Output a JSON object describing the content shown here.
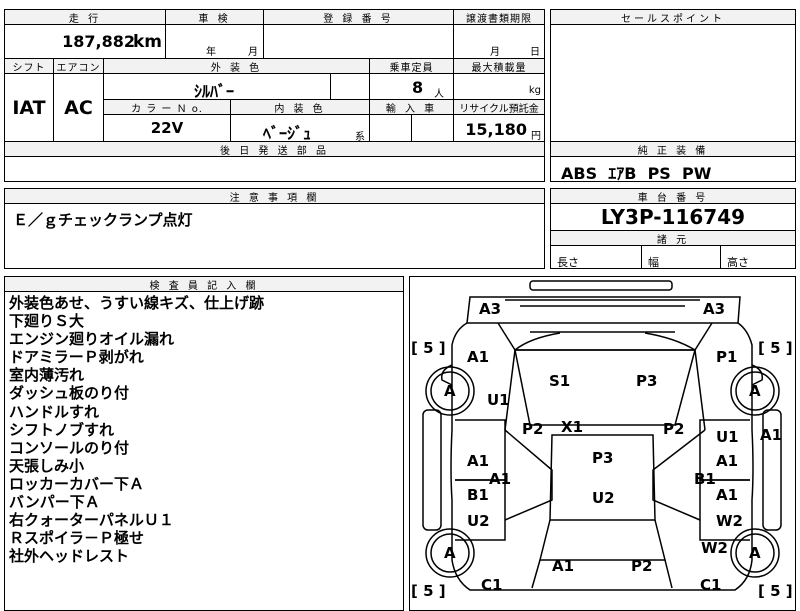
{
  "top_row": {
    "mileage_label": "走 行",
    "inspection_label": "車 検",
    "registration_label": "登 録 番 号",
    "transfer_label": "譲渡書類期限",
    "sales_point_label": "セールスポイント",
    "mileage_value": "187,882",
    "mileage_unit": "km",
    "year_unit": "年",
    "month_unit": "月",
    "month_unit2": "月",
    "day_unit": "日"
  },
  "spec_row": {
    "shift_label": "シフト",
    "aircon_label": "エアコン",
    "exterior_color_label": "外 装 色",
    "capacity_label": "乗車定員",
    "max_load_label": "最大積載量",
    "shift_value": "IAT",
    "aircon_value": "AC",
    "exterior_color_value": "ｼﾙﾊﾞｰ",
    "capacity_value": "8",
    "capacity_unit": "人",
    "load_unit": "kg",
    "color_no_label": "カ ラ ー Ｎ o.",
    "interior_color_label": "内 装 色",
    "import_label": "輸 入 車",
    "recycle_label": "リサイクル預託金",
    "color_no_value": "22V",
    "interior_color_value": "ﾍﾞｰｼﾞｭ",
    "interior_suffix": "系",
    "recycle_value": "15,180",
    "recycle_unit": "円"
  },
  "later_parts_label": "後 日 発 送 部 品",
  "equipment": {
    "label": "純 正 装 備",
    "value": "ABS  ｴｱB  PS  PW"
  },
  "caution": {
    "label": "注 意 事 項 欄",
    "value": "Ｅ／ｇチェックランプ点灯"
  },
  "chassis": {
    "label": "車 台 番 号",
    "value": "LY3P-116749"
  },
  "dimensions": {
    "label": "諸 元",
    "length_label": "長さ",
    "width_label": "幅",
    "height_label": "高さ"
  },
  "inspector": {
    "label": "検 査 員 記 入 欄",
    "lines": [
      "外装色あせ、うすい線キズ、仕上げ跡",
      "下廻りＳ大",
      "エンジン廻りオイル漏れ",
      "ドアミラーＰ剥がれ",
      "室内薄汚れ",
      "ダッシュ板のり付",
      "ハンドルすれ",
      "シフトノブすれ",
      "コンソールのり付",
      "天張しみ小",
      "ロッカーカバー下Ａ",
      "バンパー下Ａ",
      "右クォーターパネルＵ１",
      "Ｒスポイラ－Ｐ極せ",
      "社外ヘッドレスト"
    ]
  },
  "diagram": {
    "tire_label": "A",
    "tread_bracket": "[ 5 ]",
    "marks": {
      "front_left": "A3",
      "front_right": "A3",
      "fender_left": "A1",
      "fender_right": "P1",
      "mirror_left": "U1",
      "windshield_left": "S1",
      "windshield_right": "P3",
      "pillar_left": "P2",
      "pillar_right": "P2",
      "roof_top": "X1",
      "roof": "P3",
      "door_f_left": "A1",
      "door_f_right_1": "U1",
      "door_f_right_2": "A1",
      "right_edge": "A1",
      "sill_left": "A1",
      "sill_right": "B1",
      "door_r_left_1": "B1",
      "door_r_left_2": "U2",
      "door_r_right_1": "A1",
      "door_r_right_2": "W2",
      "rear_roof": "U2",
      "quarter_right": "W2",
      "trunk_left": "A1",
      "trunk_right": "P2",
      "rear_left": "C1",
      "rear_right": "C1"
    }
  }
}
